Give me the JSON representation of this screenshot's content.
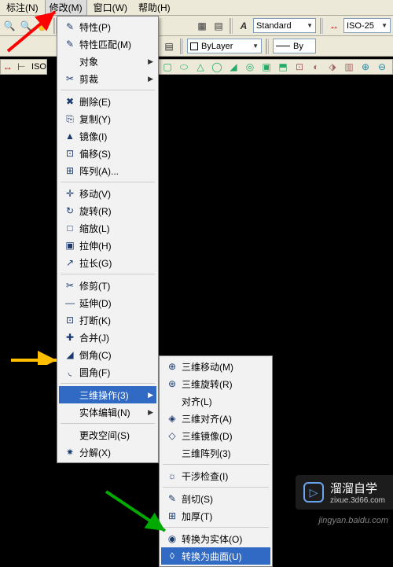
{
  "menubar": {
    "items": [
      {
        "label": "标注(N)"
      },
      {
        "label": "修改(M)"
      },
      {
        "label": "窗口(W)"
      },
      {
        "label": "帮助(H)"
      }
    ]
  },
  "toolbar1": {
    "standard_combo": "Standard",
    "iso_combo": "ISO-25"
  },
  "toolbar2": {
    "layer_combo": "ByLayer",
    "color_combo": "By"
  },
  "iso_text": "ISO",
  "modify_menu": {
    "items": [
      {
        "icon": "✎",
        "label": "特性(P)"
      },
      {
        "icon": "✎",
        "label": "特性匹配(M)"
      },
      {
        "icon": "",
        "label": "对象",
        "sub": true
      },
      {
        "icon": "✂",
        "label": "剪裁",
        "sub": true
      },
      {
        "sep": true
      },
      {
        "icon": "✖",
        "label": "删除(E)"
      },
      {
        "icon": "⎘",
        "label": "复制(Y)"
      },
      {
        "icon": "▲",
        "label": "镜像(I)"
      },
      {
        "icon": "⊡",
        "label": "偏移(S)"
      },
      {
        "icon": "⊞",
        "label": "阵列(A)..."
      },
      {
        "sep": true
      },
      {
        "icon": "✛",
        "label": "移动(V)"
      },
      {
        "icon": "↻",
        "label": "旋转(R)"
      },
      {
        "icon": "□",
        "label": "缩放(L)"
      },
      {
        "icon": "▣",
        "label": "拉伸(H)"
      },
      {
        "icon": "↗",
        "label": "拉长(G)"
      },
      {
        "sep": true
      },
      {
        "icon": "✂",
        "label": "修剪(T)"
      },
      {
        "icon": "—",
        "label": "延伸(D)"
      },
      {
        "icon": "⊡",
        "label": "打断(K)"
      },
      {
        "icon": "✚",
        "label": "合并(J)"
      },
      {
        "icon": "◢",
        "label": "倒角(C)"
      },
      {
        "icon": "◟",
        "label": "圆角(F)"
      },
      {
        "sep": true
      },
      {
        "icon": "",
        "label": "三维操作(3)",
        "sub": true,
        "hl": true
      },
      {
        "icon": "",
        "label": "实体编辑(N)",
        "sub": true
      },
      {
        "sep": true
      },
      {
        "icon": "",
        "label": "更改空间(S)"
      },
      {
        "icon": "✷",
        "label": "分解(X)"
      }
    ]
  },
  "sub_menu": {
    "items": [
      {
        "icon": "⊕",
        "label": "三维移动(M)"
      },
      {
        "icon": "⊛",
        "label": "三维旋转(R)"
      },
      {
        "icon": "",
        "label": "对齐(L)"
      },
      {
        "icon": "◈",
        "label": "三维对齐(A)"
      },
      {
        "icon": "◇",
        "label": "三维镜像(D)"
      },
      {
        "icon": "",
        "label": "三维阵列(3)"
      },
      {
        "sep": true
      },
      {
        "icon": "☼",
        "label": "干涉检查(I)"
      },
      {
        "sep": true
      },
      {
        "icon": "✎",
        "label": "剖切(S)"
      },
      {
        "icon": "⊞",
        "label": "加厚(T)"
      },
      {
        "sep": true
      },
      {
        "icon": "◉",
        "label": "转换为实体(O)"
      },
      {
        "icon": "◊",
        "label": "转换为曲面(U)",
        "hl": true
      }
    ]
  },
  "watermark": {
    "title": "溜溜自学",
    "sub": "zixue.3d66.com"
  },
  "baidu_wm": "jingyan.baidu.com"
}
